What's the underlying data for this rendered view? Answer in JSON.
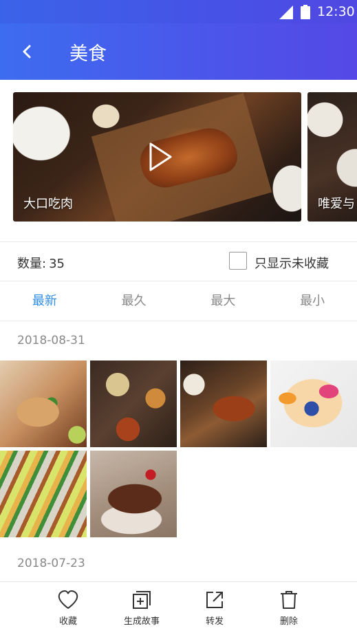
{
  "status_bar": {
    "time": "12:30",
    "icons": [
      "signal-icon",
      "battery-icon"
    ]
  },
  "app_bar": {
    "title": "美食",
    "back_icon": "chevron-left-icon"
  },
  "carousel": {
    "items": [
      {
        "caption": "大口吃肉",
        "has_video": true
      },
      {
        "caption": "唯爱与",
        "has_video": false
      }
    ]
  },
  "filter": {
    "count_label": "数量:",
    "count_value": "35",
    "unfavorited_only_label": "只显示未收藏",
    "unfavorited_only_checked": false
  },
  "sort_tabs": [
    {
      "label": "最新",
      "active": true
    },
    {
      "label": "最久",
      "active": false
    },
    {
      "label": "最大",
      "active": false
    },
    {
      "label": "最小",
      "active": false
    }
  ],
  "groups": [
    {
      "date": "2018-08-31",
      "photo_count": 6
    },
    {
      "date": "2018-07-23"
    }
  ],
  "actions": [
    {
      "label": "收藏",
      "icon": "heart-icon"
    },
    {
      "label": "生成故事",
      "icon": "add-story-icon"
    },
    {
      "label": "转发",
      "icon": "share-icon"
    },
    {
      "label": "删除",
      "icon": "trash-icon"
    }
  ],
  "colors": {
    "accent": "#2f8de6",
    "header_start": "#3d6cf0",
    "header_end": "#5548e6"
  }
}
